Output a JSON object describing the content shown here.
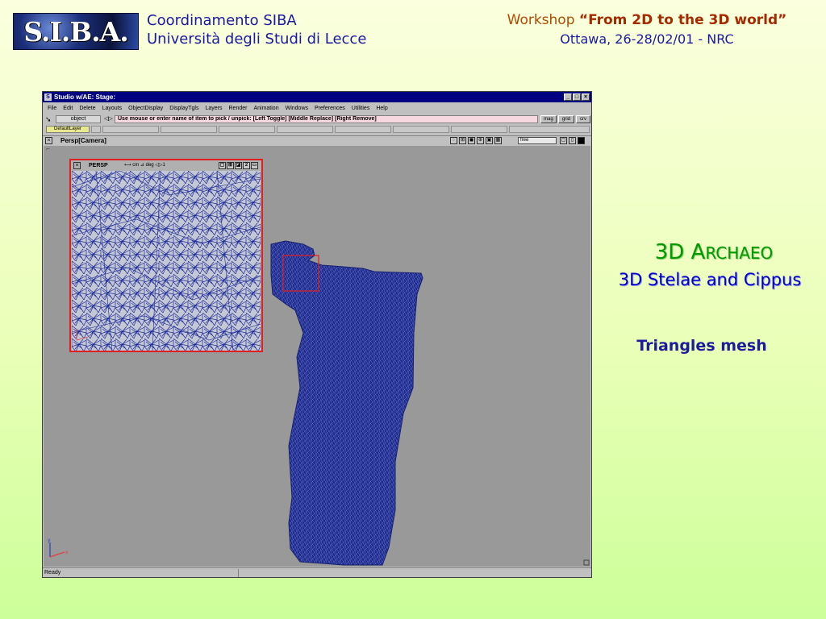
{
  "header": {
    "logo_text": "S.I.B.A.",
    "org_line1": "Coordinamento SIBA",
    "org_line2": "Università degli Studi di Lecce",
    "workshop_prefix": "Workshop ",
    "workshop_title": "“From 2D to the 3D world”",
    "workshop_place": "Ottawa, 26-28/02/01 - NRC"
  },
  "slide": {
    "title_big": "3D A",
    "title_small": "RCHAEO",
    "subtitle": "3D Stelae and Cippus",
    "caption": "Triangles mesh"
  },
  "window": {
    "title": "Studio w/AE: Stage:",
    "app_icon": "S",
    "menu": [
      "File",
      "Edit",
      "Delete",
      "Layouts",
      "ObjectDisplay",
      "DisplayTgls",
      "Layers",
      "Render",
      "Animation",
      "Windows",
      "Preferences",
      "Utilities",
      "Help"
    ],
    "mode_value": "object",
    "prompt": "Use mouse or enter name of item to pick / unpick: [Left Toggle] [Middle Replace] [Right Remove]",
    "tool_buttons": [
      "mag",
      "grid",
      "crv"
    ],
    "layer_button": "DefaultLayer",
    "view_title": "Persp[Camera]",
    "view_mode_value": "free",
    "inset_title": "PERSP",
    "inset_units": "⟷ cm  ⊿ deg  ◁▷1",
    "status": "Ready",
    "colors": {
      "titlebar": "#000080",
      "mesh": "#1e2a8e",
      "inset_border": "#e02020"
    }
  }
}
